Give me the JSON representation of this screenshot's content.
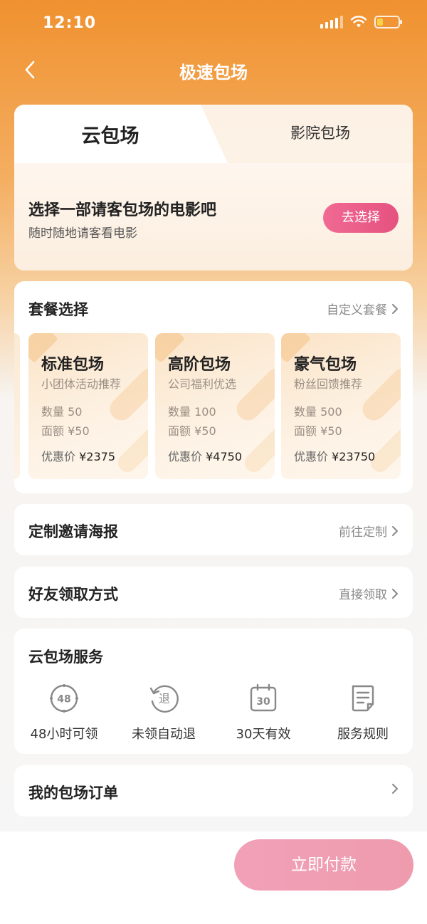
{
  "status_bar": {
    "time": "12:10"
  },
  "nav": {
    "title": "极速包场"
  },
  "tabs": {
    "active": "云包场",
    "inactive": "影院包场"
  },
  "pick_movie": {
    "title": "选择一部请客包场的电影吧",
    "subtitle": "随时随地请客看电影",
    "button": "去选择"
  },
  "packages": {
    "title": "套餐选择",
    "link": "自定义套餐",
    "items": [
      {
        "name": "标准包场",
        "desc": "小团体活动推荐",
        "qty": "数量 50",
        "face": "面额 ¥50",
        "price_label": "优惠价",
        "price": "¥2375"
      },
      {
        "name": "高阶包场",
        "desc": "公司福利优选",
        "qty": "数量 100",
        "face": "面额 ¥50",
        "price_label": "优惠价",
        "price": "¥4750"
      },
      {
        "name": "豪气包场",
        "desc": "粉丝回馈推荐",
        "qty": "数量 500",
        "face": "面额 ¥50",
        "price_label": "优惠价",
        "price": "¥23750"
      }
    ]
  },
  "poster": {
    "title": "定制邀请海报",
    "link": "前往定制"
  },
  "receive": {
    "title": "好友领取方式",
    "link": "直接领取"
  },
  "services": {
    "title": "云包场服务",
    "items": [
      {
        "label": "48小时可领",
        "icon": "clock-48-icon",
        "glyph": "48"
      },
      {
        "label": "未领自动退",
        "icon": "refund-icon",
        "glyph": "退"
      },
      {
        "label": "30天有效",
        "icon": "calendar-30-icon",
        "glyph": "30"
      },
      {
        "label": "服务规则",
        "icon": "document-icon"
      }
    ]
  },
  "orders": {
    "title": "我的包场订单"
  },
  "pay": {
    "button": "立即付款"
  },
  "colors": {
    "accent": "#E5527F",
    "header": "#F0912F",
    "pay_button": "#EE9BAD"
  }
}
